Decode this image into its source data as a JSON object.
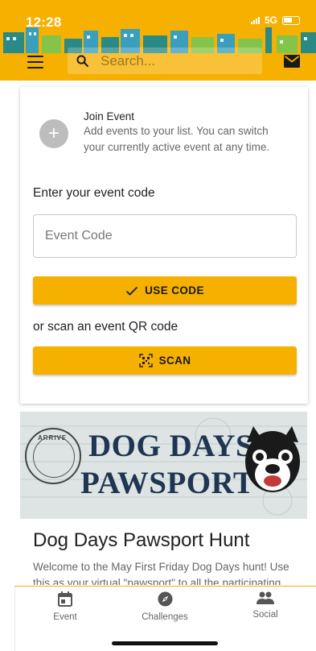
{
  "status_bar": {
    "time": "12:28",
    "network": "5G"
  },
  "header": {
    "search_placeholder": "Search...",
    "menu_icon": "hamburger-menu-icon",
    "mail_icon": "mail-icon"
  },
  "join": {
    "title": "Join Event",
    "description": "Add events to your list. You can switch your currently active event at any time."
  },
  "code": {
    "label": "Enter your event code",
    "placeholder": "Event Code",
    "value": "",
    "button_label": "USE CODE"
  },
  "scan": {
    "label": "or scan an event QR code",
    "button_label": "SCAN"
  },
  "event": {
    "banner_line1": "DOG DAYS",
    "banner_line2": "PAWSPORT",
    "stamp_text": "ARRIVE",
    "title": "Dog Days Pawsport Hunt",
    "description": "Welcome to the May First Friday Dog Days hunt! Use this as your virtual \"pawsport\" to all the participating"
  },
  "bottom_nav": [
    {
      "label": "Event",
      "icon": "calendar-icon"
    },
    {
      "label": "Challenges",
      "icon": "compass-icon"
    },
    {
      "label": "Social",
      "icon": "people-icon"
    }
  ],
  "colors": {
    "accent": "#f6b000",
    "text": "#222222",
    "muted": "#666666"
  }
}
